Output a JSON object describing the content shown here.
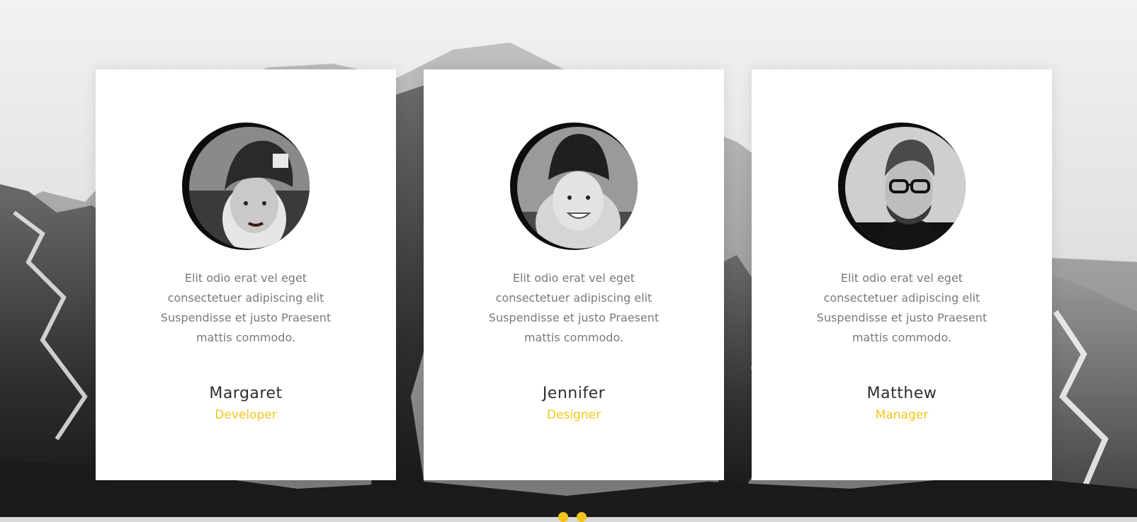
{
  "testimonials": [
    {
      "quote": "Elit odio erat vel eget consectetuer adipiscing elit Suspendisse et justo Praesent mattis commodo.",
      "name": "Margaret",
      "role": "Developer",
      "avatar_icon": "woman-beanie-portrait"
    },
    {
      "quote": "Elit odio erat vel eget consectetuer adipiscing elit Suspendisse et justo Praesent mattis commodo.",
      "name": "Jennifer",
      "role": "Designer",
      "avatar_icon": "woman-smiling-portrait"
    },
    {
      "quote": "Elit odio erat vel eget consectetuer adipiscing elit Suspendisse et justo Praesent mattis commodo.",
      "name": "Matthew",
      "role": "Manager",
      "avatar_icon": "man-glasses-portrait"
    }
  ],
  "colors": {
    "accent": "#f2c51c",
    "text": "#2d2d2d",
    "quote_text": "#7a7a7a",
    "card_bg": "#ffffff"
  }
}
